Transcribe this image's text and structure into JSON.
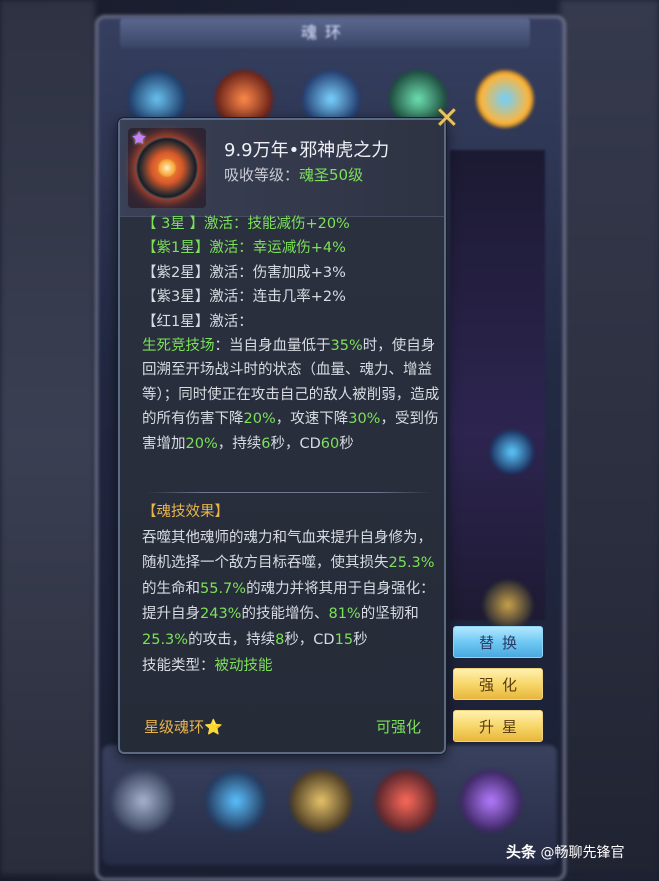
{
  "background": {
    "window_title": "魂环"
  },
  "popup": {
    "title": "9.9万年•邪神虎之力",
    "absorb_label": "吸收等级：",
    "absorb_value": "魂圣50级",
    "star_lines": [
      {
        "tag": "【  3星  】",
        "label": "激活：",
        "effect": "技能减伤+20%",
        "active": true
      },
      {
        "tag": "【紫1星】",
        "label": "激活：",
        "effect": "幸运减伤+4%",
        "active": true
      },
      {
        "tag": "【紫2星】",
        "label": "激活：",
        "effect": "伤害加成+3%",
        "active": false
      },
      {
        "tag": "【紫3星】",
        "label": "激活：",
        "effect": "连击几率+2%",
        "active": false
      },
      {
        "tag": "【红1星】",
        "label": "激活：",
        "effect": "",
        "active": false
      }
    ],
    "red_star_skill": {
      "name": "生死竞技场",
      "p1": "：当自身血量低于",
      "v1": "35%",
      "p2": "时，使自身回溯至开场战斗时的状态（血量、魂力、增益等）；同时使正在攻击自己的敌人被削弱，造成的所有伤害下降",
      "v2": "20%",
      "p3": "，攻速下降",
      "v3": "30%",
      "p4": "，受到伤害增加",
      "v4": "20%",
      "p5": "，持续",
      "v5": "6",
      "p6": "秒，CD",
      "v6": "60",
      "p7": "秒"
    },
    "skill_effect_header": "【魂技效果】",
    "skill_effect": {
      "p1": "吞噬其他魂师的魂力和气血来提升自身修为，随机选择一个敌方目标吞噬，使其损失",
      "v1": "25.3%",
      "p2": "的生命和",
      "v2": "55.7%",
      "p3": "的魂力并将其用于自身强化：提升自身",
      "v3": "243%",
      "p4": "的技能增伤、",
      "v4": "81%",
      "p5": "的坚韧和",
      "v5": "25.3%",
      "p6": "的攻击，持续",
      "v6": "8",
      "p7": "秒，CD",
      "v7": "15",
      "p8": "秒"
    },
    "skill_type_label": "技能类型：",
    "skill_type_value": "被动技能",
    "footer_left": "星级魂环⭐",
    "footer_right": "可强化",
    "close_symbol": "✕"
  },
  "side_buttons": {
    "replace": "替换",
    "enhance": "强化",
    "star_up": "升星"
  },
  "watermark": {
    "brand": "头条",
    "account": "@畅聊先锋官"
  },
  "colors": {
    "highlight_green": "#7be05a",
    "gold": "#e8b44c",
    "text": "#d8dbe2"
  }
}
